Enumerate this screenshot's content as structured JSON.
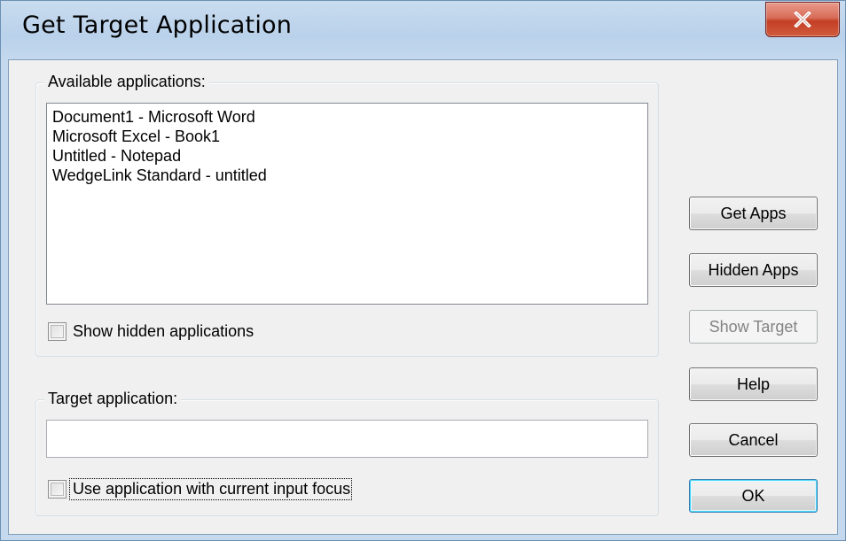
{
  "window": {
    "title": "Get Target Application",
    "close_icon": "close-icon"
  },
  "available_group": {
    "label": "Available applications:",
    "items": [
      {
        "label": "Document1 - Microsoft Word"
      },
      {
        "label": "Microsoft Excel - Book1"
      },
      {
        "label": "Untitled - Notepad"
      },
      {
        "label": "WedgeLink Standard - untitled"
      }
    ],
    "show_hidden_label": "Show hidden applications",
    "show_hidden_checked": false
  },
  "target_group": {
    "label": "Target application:",
    "value": "",
    "use_focus_label": "Use application with current input focus",
    "use_focus_checked": false
  },
  "buttons": {
    "get_apps": "Get Apps",
    "hidden_apps": "Hidden Apps",
    "show_target": "Show Target",
    "help": "Help",
    "cancel": "Cancel",
    "ok": "OK"
  }
}
